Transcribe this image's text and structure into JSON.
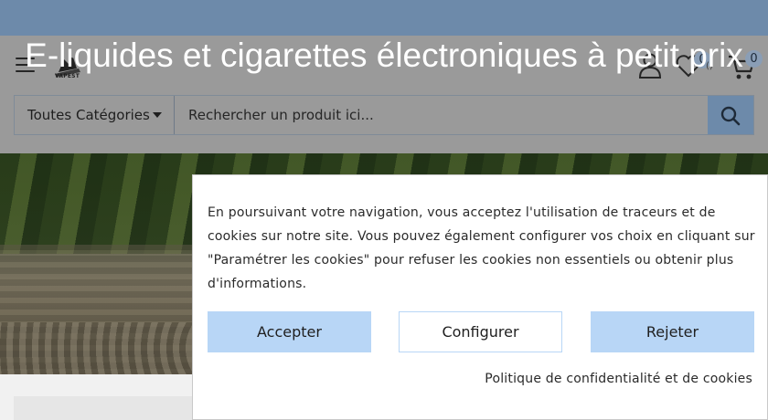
{
  "header": {
    "logo_text": "VAPEST",
    "wishlist_count": "0",
    "wishlist_paren": "()",
    "cart_count": "0"
  },
  "search": {
    "category_label": "Toutes Catégories",
    "placeholder": "Rechercher un produit ici..."
  },
  "hero": {
    "title": "E-liquides et cigarettes électroniques à petit prix"
  },
  "cookie_banner": {
    "text_line_1": "En poursuivant votre navigation, vous acceptez l'utilisation de traceurs et de",
    "text_line_2": "cookies sur notre site. Vous pouvez également configurer vos choix en cliquant sur",
    "text_line_3": "\"Paramétrer les cookies\" pour refuser les cookies non essentiels ou obtenir plus",
    "text_line_4": "d'informations.",
    "accept_label": "Accepter",
    "configure_label": "Configurer",
    "reject_label": "Rejeter",
    "policy_link": "Politique de confidentialité et de cookies"
  },
  "colors": {
    "topbar": "#6d8aaa",
    "button_blue": "#b8d6f6",
    "overlay_header": "#9a9a9a"
  }
}
